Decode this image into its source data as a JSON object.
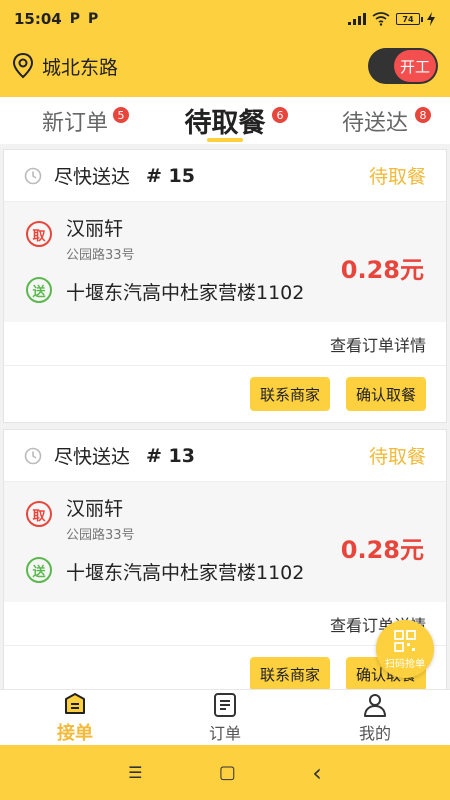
{
  "status": {
    "time": "15:04",
    "p1": "P",
    "p2": "P",
    "battery": "74"
  },
  "header": {
    "location": "城北东路",
    "toggle_label": "开工"
  },
  "tabs": [
    {
      "label": "新订单",
      "badge": "5"
    },
    {
      "label": "待取餐",
      "badge": "6"
    },
    {
      "label": "待送达",
      "badge": "8"
    }
  ],
  "orders": [
    {
      "title": "尽快送达",
      "number": "# 15",
      "status": "待取餐",
      "pick_tag": "取",
      "shop": "汉丽轩",
      "shop_address": "公园路33号",
      "drop_tag": "送",
      "destination": "十堰东汽高中杜家营楼1102",
      "price": "0.28元",
      "detail": "查看订单详情",
      "contact_btn": "联系商家",
      "confirm_btn": "确认取餐"
    },
    {
      "title": "尽快送达",
      "number": "# 13",
      "status": "待取餐",
      "pick_tag": "取",
      "shop": "汉丽轩",
      "shop_address": "公园路33号",
      "drop_tag": "送",
      "destination": "十堰东汽高中杜家营楼1102",
      "price": "0.28元",
      "detail": "查看订单详情",
      "contact_btn": "联系商家",
      "confirm_btn": "确认取餐"
    }
  ],
  "fab": {
    "label": "扫码抢单"
  },
  "nav": [
    {
      "label": "接单",
      "icon": "list-box-icon"
    },
    {
      "label": "订单",
      "icon": "document-icon"
    },
    {
      "label": "我的",
      "icon": "person-icon"
    }
  ],
  "system_nav": {
    "menu": "☰",
    "home": "▢",
    "back": "‹"
  },
  "colors": {
    "accent": "#fcd03e",
    "price_red": "#e8463c",
    "pick_red": "#e8463c",
    "drop_green": "#5bb84e",
    "status_orange": "#f2b93a"
  }
}
